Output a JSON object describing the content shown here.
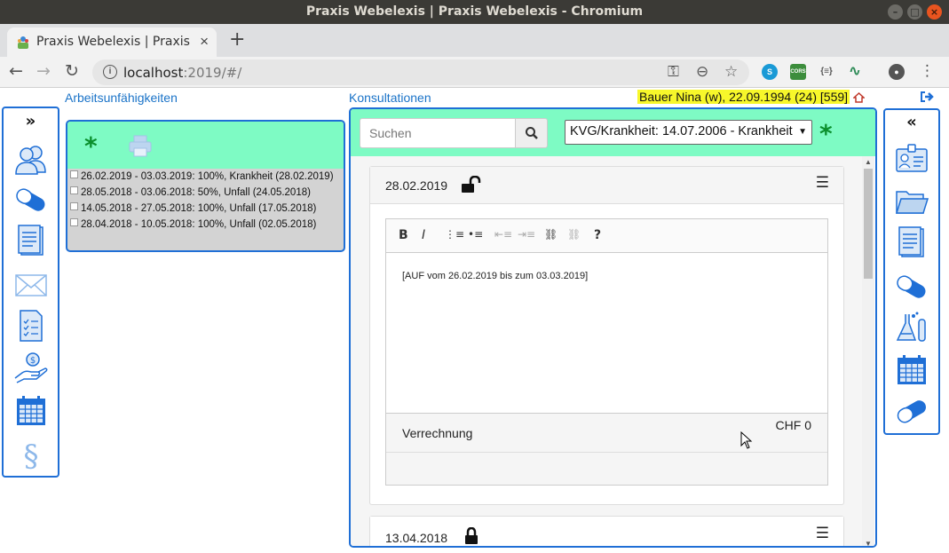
{
  "window": {
    "title": "Praxis Webelexis | Praxis Webelexis - Chromium"
  },
  "browser": {
    "tab_title": "Praxis Webelexis | Praxis Webelexis",
    "url_host": "localhost",
    "url_rest": ":2019/#/",
    "ext_cors": "CORS",
    "ext_curly": "{≡}"
  },
  "header": {
    "auf_title": "Arbeitsunfähigkeiten",
    "kons_title": "Konsultationen",
    "patient": "Bauer Nina (w), 22.09.1994 (24) [559]"
  },
  "left_sidebar": {
    "toggle": "»"
  },
  "right_sidebar": {
    "toggle": "«"
  },
  "auf": {
    "add_glyph": "*",
    "items": [
      "26.02.2019 - 03.03.2019: 100%, Krankheit (28.02.2019)",
      "28.05.2018 - 03.06.2018: 50%, Unfall  (24.05.2018)",
      "14.05.2018 - 27.05.2018: 100%, Unfall  (17.05.2018)",
      "28.04.2018 - 10.05.2018: 100%, Unfall  (02.05.2018)"
    ]
  },
  "kons": {
    "search_placeholder": "Suchen",
    "fall_selected": "KVG/Krankheit: 14.07.2006 - Krankheit",
    "add_glyph": "*",
    "entries": [
      {
        "date": "28.02.2019",
        "text": "[AUF vom 26.02.2019 bis zum 03.03.2019]",
        "billing_label": "Verrechnung",
        "billing_amount": "CHF 0"
      },
      {
        "date": "13.04.2018"
      }
    ],
    "editor_toolbar": {
      "bold": "B",
      "italic": "I",
      "help": "?"
    }
  },
  "colors": {
    "accent_blue": "#1f6fd6",
    "panel_green": "#7efbc4",
    "patient_highlight": "#f7f72a",
    "add_green": "#0b8f2d"
  }
}
